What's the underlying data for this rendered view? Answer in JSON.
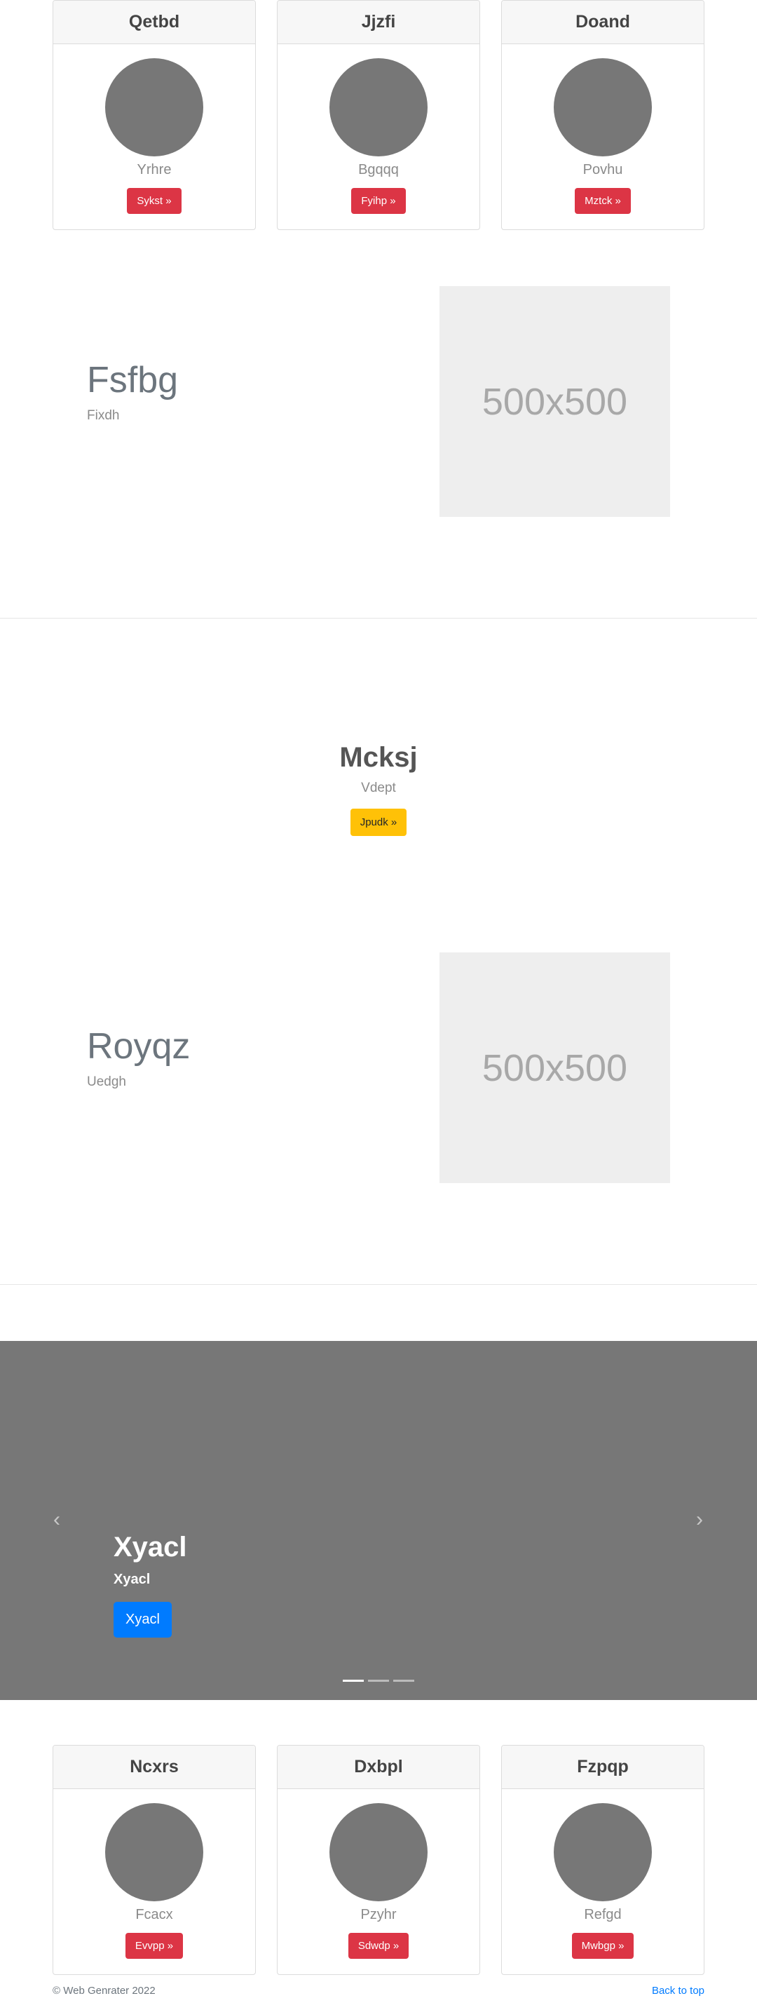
{
  "top_cards": [
    {
      "header": "Qetbd",
      "text": "Yrhre",
      "button": "Sykst »"
    },
    {
      "header": "Jjzfi",
      "text": "Bgqqq",
      "button": "Fyihp »"
    },
    {
      "header": "Doand",
      "text": "Povhu",
      "button": "Mztck »"
    }
  ],
  "feature_1": {
    "title": "Fsfbg",
    "subtitle": "Fixdh",
    "image_label": "500x500"
  },
  "center_section": {
    "title": "Mcksj",
    "subtitle": "Vdept",
    "button": "Jpudk »"
  },
  "feature_2": {
    "title": "Royqz",
    "subtitle": "Uedgh",
    "image_label": "500x500"
  },
  "carousel": {
    "title": "Xyacl",
    "subtitle": "Xyacl",
    "button": "Xyacl",
    "prev_icon": "‹",
    "next_icon": "›",
    "slide_count": 3,
    "active_slide": 1
  },
  "bottom_cards": [
    {
      "header": "Ncxrs",
      "text": "Fcacx",
      "button": "Evvpp »"
    },
    {
      "header": "Dxbpl",
      "text": "Pzyhr",
      "button": "Sdwdp »"
    },
    {
      "header": "Fzpqp",
      "text": "Refgd",
      "button": "Mwbgp »"
    }
  ],
  "footer": {
    "copyright": "© Web Genrater 2022",
    "back_to_top": "Back to top"
  },
  "colors": {
    "danger": "#dc3545",
    "warning": "#ffc107",
    "primary": "#007bff",
    "placeholder_gray": "#777777"
  }
}
